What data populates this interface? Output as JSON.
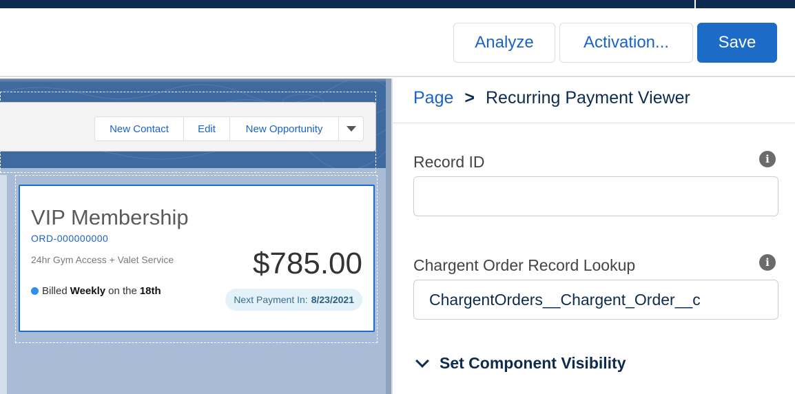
{
  "header": {
    "analyze_label": "Analyze",
    "activation_label": "Activation...",
    "save_label": "Save"
  },
  "canvas": {
    "actions": {
      "new_contact": "New Contact",
      "edit": "Edit",
      "new_opportunity": "New Opportunity"
    },
    "card": {
      "title": "VIP Membership",
      "order_number": "ORD-000000000",
      "description": "24hr Gym Access + Valet Service",
      "billed_prefix": "Billed",
      "billed_frequency": "Weekly",
      "billed_middle": "on the",
      "billed_day": "18th",
      "amount": "$785.00",
      "next_payment_label": "Next Payment In:",
      "next_payment_date": "8/23/2021"
    }
  },
  "panel": {
    "breadcrumb_page": "Page",
    "breadcrumb_separator": ">",
    "breadcrumb_current": "Recurring Payment Viewer",
    "record_id_label": "Record ID",
    "record_id_value": "",
    "lookup_label": "Chargent Order Record Lookup",
    "lookup_value": "ChargentOrders__Chargent_Order__c",
    "visibility_label": "Set Component Visibility",
    "info_icon": "i"
  },
  "colors": {
    "brand_blue": "#1b6bc7",
    "navy": "#0d2b4e",
    "canvas_bg": "#a8bcd8"
  }
}
